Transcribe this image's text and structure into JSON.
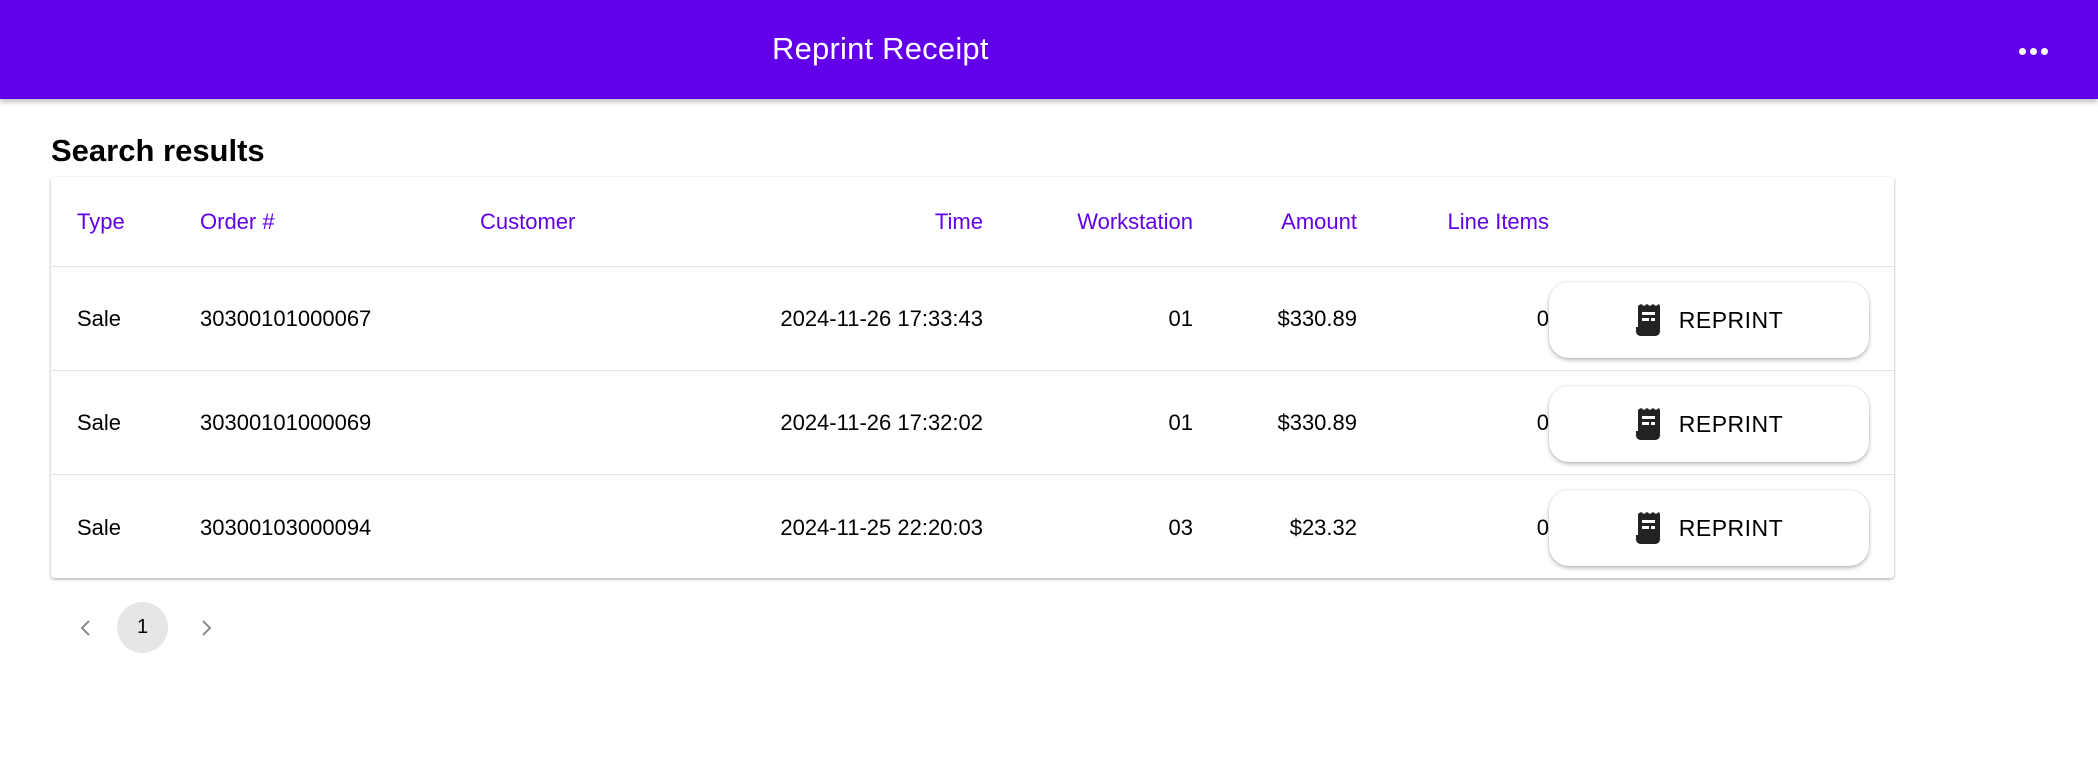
{
  "app_bar": {
    "title": "Reprint Receipt",
    "menu_icon": "more-horiz-icon",
    "background_color": "#6200ea"
  },
  "results": {
    "title": "Search results",
    "columns": [
      "Type",
      "Order #",
      "Customer",
      "Time",
      "Workstation",
      "Amount",
      "Line Items"
    ],
    "rows": [
      {
        "type": "Sale",
        "order": "30300101000067",
        "customer": "",
        "time": "2024-11-26 17:33:43",
        "workstation": "01",
        "amount": "$330.89",
        "line_items": "0",
        "action": "REPRINT"
      },
      {
        "type": "Sale",
        "order": "30300101000069",
        "customer": "",
        "time": "2024-11-26 17:32:02",
        "workstation": "01",
        "amount": "$330.89",
        "line_items": "0",
        "action": "REPRINT"
      },
      {
        "type": "Sale",
        "order": "30300103000094",
        "customer": "",
        "time": "2024-11-25 22:20:03",
        "workstation": "03",
        "amount": "$23.32",
        "line_items": "0",
        "action": "REPRINT"
      }
    ],
    "action_icon": "receipt-icon",
    "header_color": "#6200ea"
  },
  "pagination": {
    "current_page": "1",
    "prev_icon": "chevron-left-icon",
    "next_icon": "chevron-right-icon"
  }
}
